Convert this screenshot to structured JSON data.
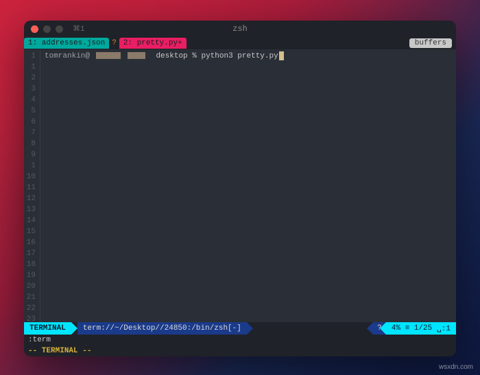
{
  "titlebar": {
    "tab_indicator": "⌘1",
    "title": "zsh"
  },
  "buffers": {
    "tabs": [
      {
        "label": "1: addresses.json",
        "active": false
      },
      {
        "label": "2: pretty.py+",
        "active": true
      }
    ],
    "tab_icon_char": "?",
    "label": "buffers"
  },
  "gutter_lines": [
    "1",
    "1",
    "2",
    "3",
    "4",
    "5",
    "6",
    "7",
    "8",
    "9",
    "1",
    "10",
    "11",
    "12",
    "13",
    "14",
    "15",
    "16",
    "17",
    "18",
    "19",
    "20",
    "21",
    "22",
    "23"
  ],
  "prompt": {
    "user": "tomrankin@",
    "path": "desktop",
    "separator": "%",
    "command": "python3 pretty.py"
  },
  "statusline": {
    "mode": "TERMINAL",
    "path": "term://~/Desktop//24850:/bin/zsh[-]",
    "icon_char": "?",
    "percent": "4%",
    "line_info": "≡ 1/25",
    "col_info": "␣:1"
  },
  "command_line": ":term",
  "mode_line": "-- TERMINAL --",
  "watermark": "wsxdn.com"
}
